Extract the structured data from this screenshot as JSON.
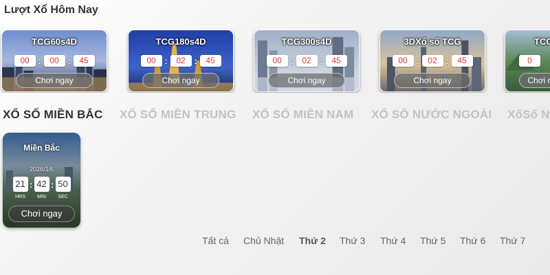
{
  "section_title": "Lượt Xổ Hôm Nay",
  "games": [
    {
      "name": "TCG60s4D",
      "timer": [
        "00",
        "00",
        "45"
      ],
      "play_label": "Chơi ngay"
    },
    {
      "name": "TCG180s4D",
      "timer": [
        "00",
        "02",
        "45"
      ],
      "play_label": "Chơi ngay"
    },
    {
      "name": "TCG300s4D",
      "timer": [
        "00",
        "02",
        "45"
      ],
      "play_label": "Chơi ngay"
    },
    {
      "name": "3DXổ số TCG",
      "timer": [
        "00",
        "02",
        "45"
      ],
      "play_label": "Chơi ngay"
    },
    {
      "name": "TCG",
      "timer": [
        "0"
      ],
      "play_label": "Chơi ngay"
    }
  ],
  "region_tabs": [
    {
      "label": "XỔ SỐ MIỀN BẮC",
      "active": true
    },
    {
      "label": "XỔ SỐ MIỀN TRUNG",
      "active": false
    },
    {
      "label": "XỔ SỐ MIỀN NAM",
      "active": false
    },
    {
      "label": "XỔ SỐ NƯỚC NGOÀI",
      "active": false
    },
    {
      "label": "XốSố NI",
      "active": false
    }
  ],
  "mien_bac": {
    "title": "Miền Bắc",
    "date": "2026/1/6",
    "hrs": "21",
    "min": "42",
    "sec": "50",
    "hrs_label": "HRS",
    "min_label": "MIN",
    "sec_label": "SEC",
    "play_label": "Chơi ngay"
  },
  "day_tabs": [
    {
      "label": "Tất cả",
      "active": false
    },
    {
      "label": "Chủ Nhật",
      "active": false
    },
    {
      "label": "Thứ 2",
      "active": true
    },
    {
      "label": "Thứ 3",
      "active": false
    },
    {
      "label": "Thứ 4",
      "active": false
    },
    {
      "label": "Thứ 5",
      "active": false
    },
    {
      "label": "Thứ 6",
      "active": false
    },
    {
      "label": "Thứ 7",
      "active": false
    }
  ],
  "colors": {
    "timer_digit": "#d9363e",
    "active_text": "#333333",
    "inactive_region": "#c2c2c2"
  }
}
